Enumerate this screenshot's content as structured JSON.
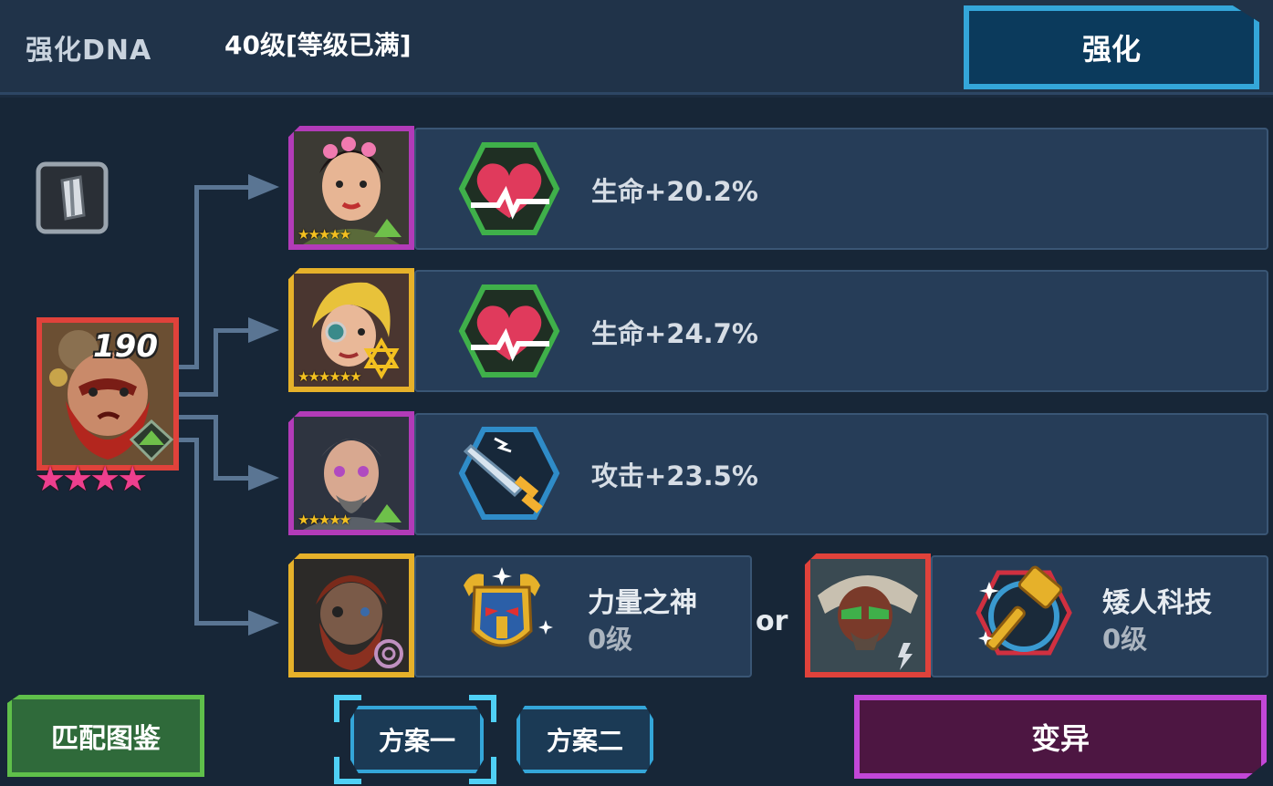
{
  "header": {
    "title": "强化DNA",
    "level": "40级[等级已满]",
    "enhance_label": "强化"
  },
  "hero": {
    "level": "190",
    "stars": "★★★★"
  },
  "dna_rows": [
    {
      "stars": "★★★★★",
      "stat": "生命+20.2%",
      "frame": "#b23bb8",
      "icon": "heart-icon"
    },
    {
      "stars": "★★★★★★",
      "stat": "生命+24.7%",
      "frame": "#e6b12a",
      "icon": "heart-icon"
    },
    {
      "stars": "★★★★★",
      "stat": "攻击+23.5%",
      "frame": "#b23bb8",
      "icon": "sword-icon"
    }
  ],
  "bonus": {
    "left": {
      "name": "力量之神",
      "level": "0级",
      "frame": "#e6b12a",
      "icon": "golden-mask-icon"
    },
    "or_label": "or",
    "right": {
      "name": "矮人科技",
      "level": "0级",
      "frame": "#e0423b",
      "icon": "golden-hammer-icon"
    }
  },
  "footer": {
    "match_label": "匹配图鉴",
    "plan_one": "方案一",
    "plan_two": "方案二",
    "mutate_label": "变异"
  },
  "colors": {
    "accent_blue": "#34a6d9",
    "green": "#5fbf4a",
    "purple": "#c247d8",
    "gold": "#e6b12a",
    "red": "#e0423b"
  }
}
